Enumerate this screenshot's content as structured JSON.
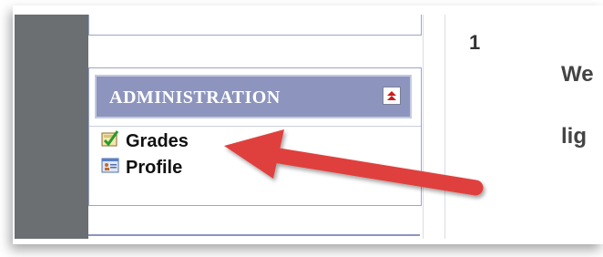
{
  "sidebar": {
    "section_title": "ADMINISTRATION",
    "collapse_icon": "collapse-up-icon",
    "items": [
      {
        "label": "Grades",
        "icon": "grades-icon"
      },
      {
        "label": "Profile",
        "icon": "profile-icon"
      }
    ]
  },
  "content": {
    "line_number": "1",
    "snippet_line1": "We",
    "snippet_line2": "lig"
  },
  "annotation": {
    "arrow_color": "#e0403c"
  },
  "colors": {
    "header_bg": "#8d95be",
    "left_strip": "#6b6f72",
    "block_border": "#9aa6c4"
  }
}
